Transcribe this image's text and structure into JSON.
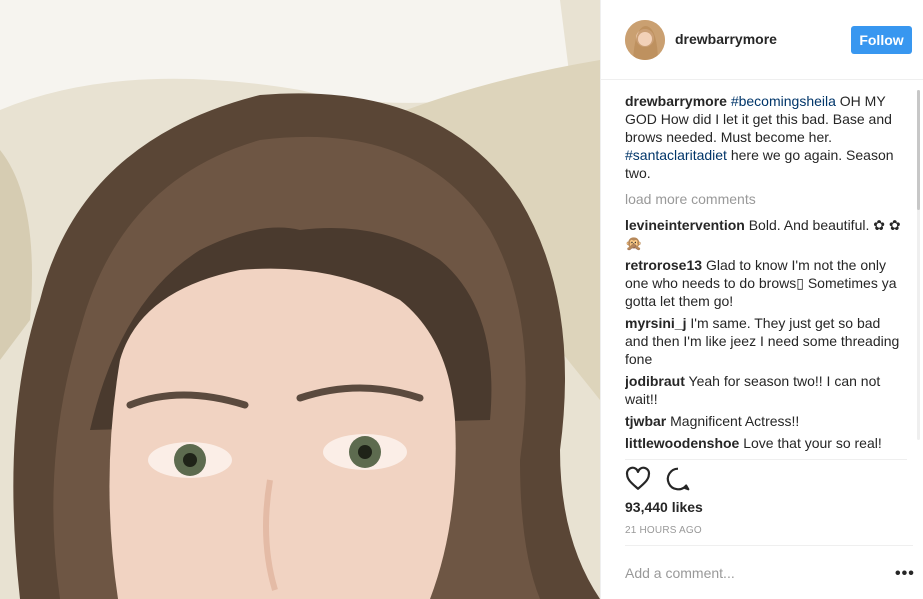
{
  "post": {
    "username": "drewbarrymore",
    "follow_label": "Follow",
    "caption": {
      "username": "drewbarrymore",
      "tag1": "#becomingsheila",
      "text1": " OH MY GOD How did I let it get this bad. Base and brows needed. Must become her. ",
      "tag2": "#santaclaritadiet",
      "text2": " here we go again. Season two."
    },
    "load_more": "load more comments",
    "comments": [
      {
        "user": "levineintervention",
        "text": "Bold. And beautiful. ✿ ✿🙊"
      },
      {
        "user": "retrorose13",
        "text": "Glad to know I'm not the only one who needs to do brows▯ Sometimes ya gotta let them go!"
      },
      {
        "user": "myrsini_j",
        "text": "I'm same. They just get so bad and then I'm like jeez I need some threading fone"
      },
      {
        "user": "jodibraut",
        "text": "Yeah for season two!! I can not wait!!"
      },
      {
        "user": "tjwbar",
        "text": "Magnificent Actress!!"
      },
      {
        "user": "littlewoodenshoe",
        "text": "Love that your so real!"
      }
    ],
    "likes": "93,440 likes",
    "time": "21 HOURS AGO",
    "add_comment_placeholder": "Add a comment...",
    "more_label": "•••"
  },
  "icons": {
    "like": "heart-icon",
    "comment": "comment-bubble-icon",
    "more": "more-options-icon"
  },
  "colors": {
    "follow_bg": "#3897f0",
    "hashtag": "#003569",
    "muted": "#999999"
  }
}
